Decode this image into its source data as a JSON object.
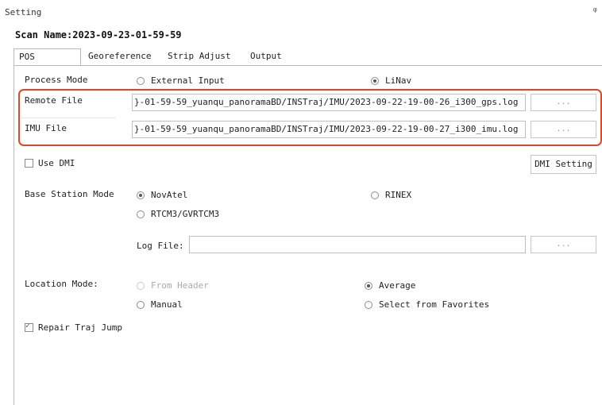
{
  "window": {
    "title": "Setting",
    "pin_glyph": "ᵠ"
  },
  "scan": {
    "label": "Scan Name:2023-09-23-01-59-59"
  },
  "tabs": [
    {
      "label": "POS Process",
      "active": true
    },
    {
      "label": "Georeference",
      "active": false
    },
    {
      "label": "Strip Adjust",
      "active": false
    },
    {
      "label": "Output",
      "active": false
    }
  ],
  "process_mode": {
    "label": "Process Mode",
    "options": [
      {
        "label": "External Input",
        "selected": false
      },
      {
        "label": "LiNav",
        "selected": true
      }
    ]
  },
  "remote_file": {
    "label": "Remote File",
    "value": "}-01-59-59_yuanqu_panoramaBD/INSTraj/IMU/2023-09-22-19-00-26_i300_gps.log",
    "browse_label": "..."
  },
  "imu_file": {
    "label": "IMU File",
    "value": "}-01-59-59_yuanqu_panoramaBD/INSTraj/IMU/2023-09-22-19-00-27_i300_imu.log",
    "browse_label": "..."
  },
  "dmi": {
    "label": "Use DMI",
    "checked": false,
    "setting_button": "DMI Setting"
  },
  "base_station": {
    "label": "Base Station Mode",
    "options": [
      {
        "label": "NovAtel",
        "selected": true
      },
      {
        "label": "RINEX",
        "selected": false
      },
      {
        "label": "RTCM3/GVRTCM3",
        "selected": false
      }
    ],
    "log_file_label": "Log File:",
    "log_file_value": "",
    "browse_label": "..."
  },
  "location_mode": {
    "label": "Location Mode:",
    "options": [
      {
        "label": "From Header",
        "selected": false,
        "disabled": true
      },
      {
        "label": "Average",
        "selected": true
      },
      {
        "label": "Manual",
        "selected": false
      },
      {
        "label": "Select from Favorites",
        "selected": false
      }
    ]
  },
  "repair_traj": {
    "label": "Repair Traj Jump",
    "checked": true,
    "tick_glyph": "✓"
  },
  "colors": {
    "highlight": "#d94a2a",
    "border": "#b9b9b9"
  }
}
